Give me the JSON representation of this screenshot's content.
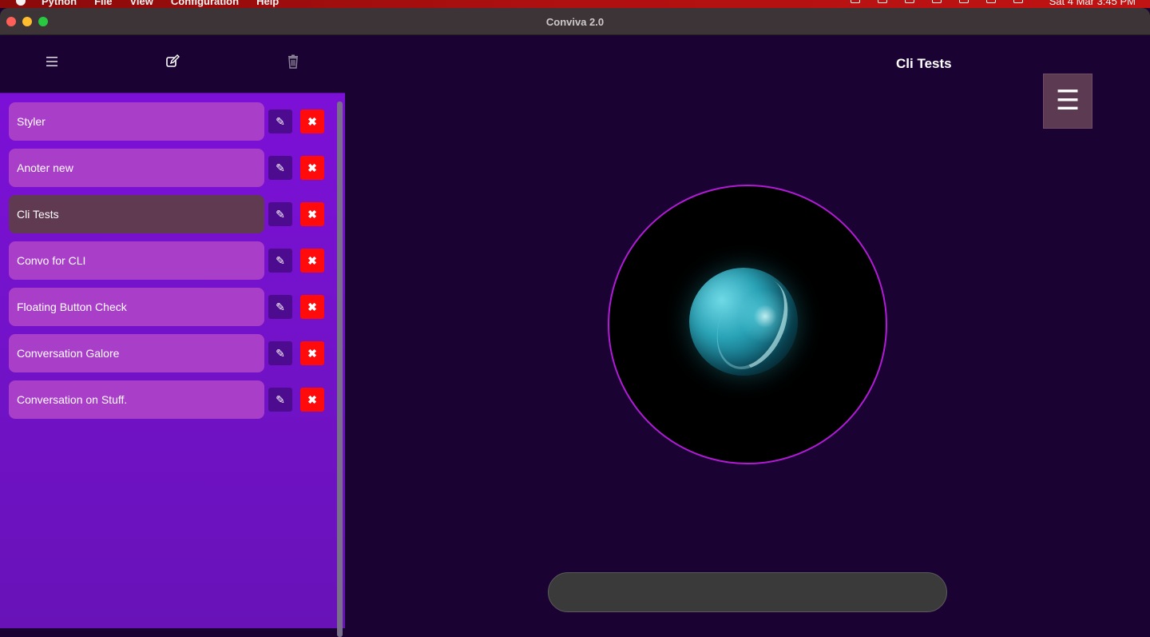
{
  "menubar": {
    "app_name": "Python",
    "menus": [
      "File",
      "View",
      "Configuration",
      "Help"
    ],
    "clock": "Sat 4 Mar 3:45 PM"
  },
  "window": {
    "title": "Conviva 2.0"
  },
  "sidebar": {
    "toolbar": {
      "menu_icon": "hamburger-icon",
      "new_icon": "edit-icon",
      "delete_icon": "trash-icon"
    },
    "conversations": [
      {
        "label": "Styler",
        "active": false
      },
      {
        "label": "Anoter new",
        "active": false
      },
      {
        "label": "Cli Tests",
        "active": true
      },
      {
        "label": "Convo for CLI",
        "active": false
      },
      {
        "label": "Floating Button Check",
        "active": false
      },
      {
        "label": "Conversation Galore",
        "active": false
      },
      {
        "label": "Conversation on Stuff.",
        "active": false
      }
    ],
    "edit_glyph": "✎",
    "delete_glyph": "✖"
  },
  "main": {
    "conversation_title": "Cli Tests",
    "menu_glyph": "☰",
    "chat_input": {
      "value": "",
      "placeholder": ""
    }
  },
  "colors": {
    "background": "#1a0332",
    "sidebar": "#7c10d6",
    "item": "#a93ec9",
    "item_active": "#5f3a50",
    "edit_button": "#4d0c8f",
    "delete_button": "#ff0b0b",
    "orb_ring": "#b31ad8"
  }
}
